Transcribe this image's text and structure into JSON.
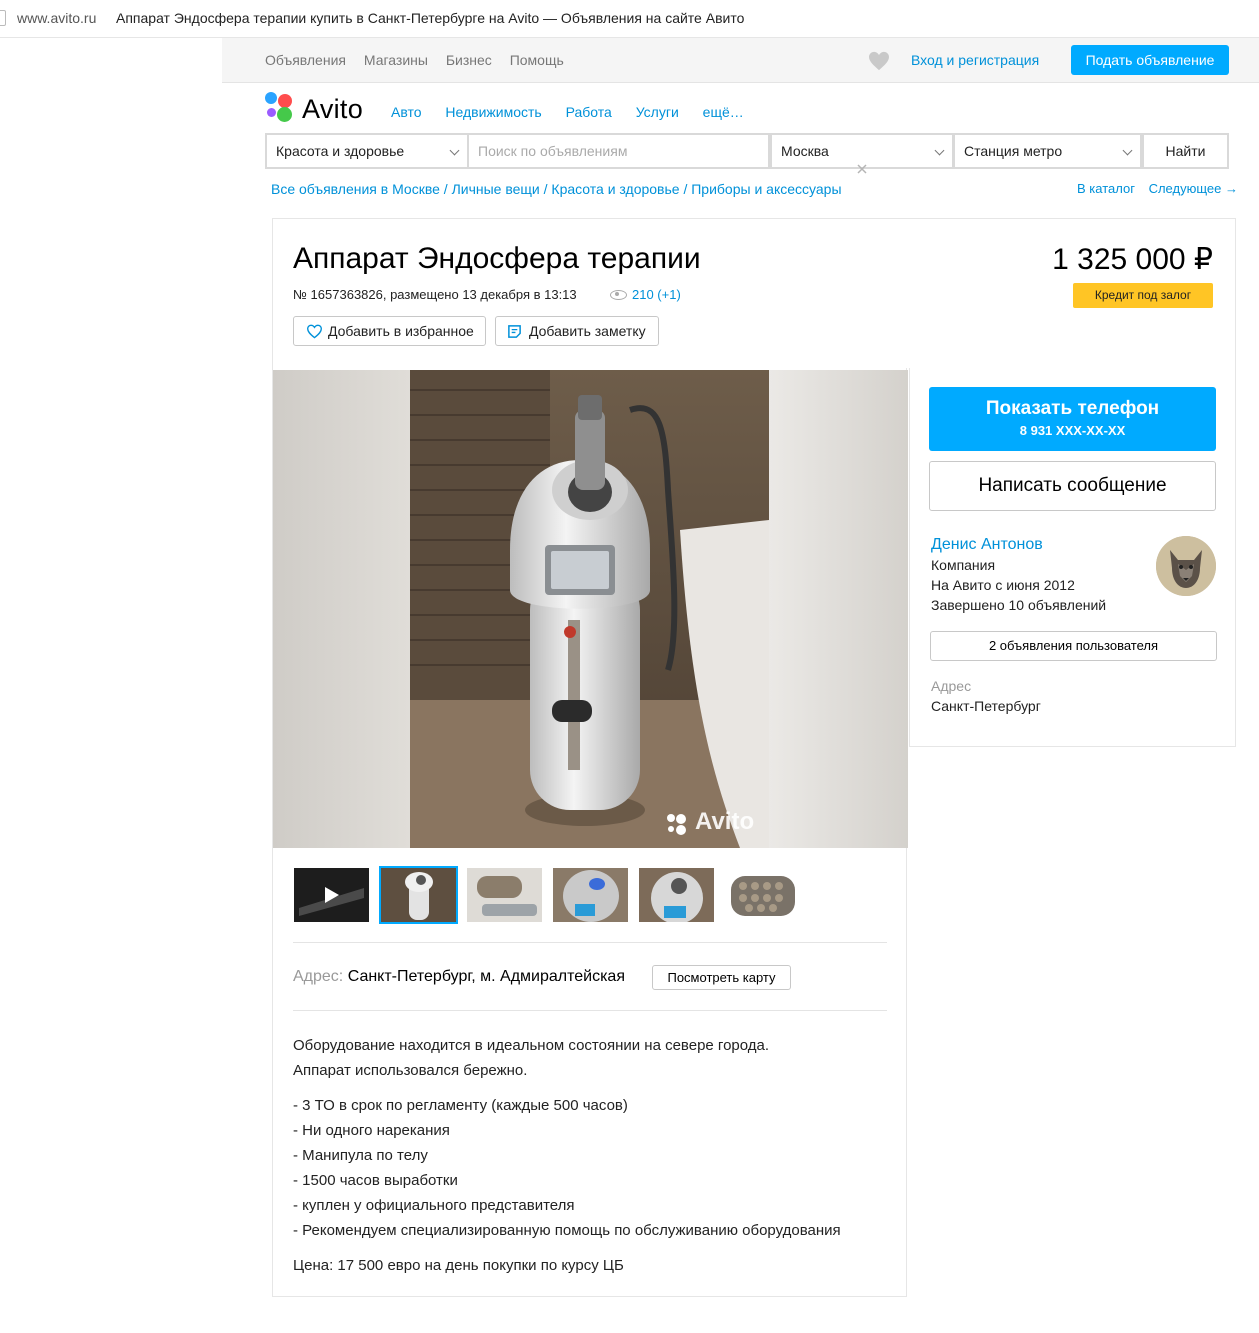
{
  "browser": {
    "url": "www.avito.ru",
    "title": "Аппарат Эндосфера терапии купить в Санкт-Петербурге на Avito — Объявления на сайте Авито"
  },
  "topnav": {
    "links": [
      "Объявления",
      "Магазины",
      "Бизнес",
      "Помощь"
    ],
    "login": "Вход и регистрация",
    "post_ad": "Подать объявление"
  },
  "logo": {
    "text": "Avito"
  },
  "categories": [
    "Авто",
    "Недвижимость",
    "Работа",
    "Услуги",
    "ещё…"
  ],
  "search": {
    "category": "Красота и здоровье",
    "placeholder": "Поиск по объявлениям",
    "city": "Москва",
    "metro": "Станция метро",
    "button": "Найти"
  },
  "breadcrumbs": "Все объявления в Москве / Личные вещи / Красота и здоровье / Приборы и аксессуары",
  "crumb_links": [
    "В каталог",
    "Следующее →"
  ],
  "item": {
    "title": "Аппарат Эндосфера терапии",
    "meta": "№ 1657363826, размещено 13 декабря в 13:13",
    "views": "210 (+1)",
    "add_favorite": "Добавить в избранное",
    "add_note": "Добавить заметку",
    "price": "1 325 000 ₽",
    "credit": "Кредит под залог",
    "watermark": "Avito"
  },
  "address": {
    "label": "Адрес:",
    "value": "Санкт-Петербург, м. Адмиралтейская",
    "map_button": "Посмотреть карту"
  },
  "description": {
    "intro1": "Оборудование находится в идеальном состоянии на севере города.",
    "intro2": "Аппарат использовался бережно.",
    "bullets": [
      "- 3 ТО в срок по регламенту (каждые 500 часов)",
      "- Ни одного нарекания",
      "- Манипула по телу",
      "- 1500 часов выработки",
      "- куплен у официального представителя",
      "- Рекомендуем специализированную помощь по обслуживанию оборудования"
    ],
    "price_note": "Цена: 17 500 евро на день покупки по курсу ЦБ"
  },
  "seller": {
    "show_phone": "Показать телефон",
    "phone_mask": "8 931 XXX-XX-XX",
    "write_message": "Написать сообщение",
    "name": "Денис Антонов",
    "type": "Компания",
    "since": "На Авито с июня 2012",
    "completed": "Завершено 10 объявлений",
    "user_ads": "2 объявления пользователя",
    "address_label": "Адрес",
    "address": "Санкт-Петербург"
  },
  "colors": {
    "accent": "#00aaff",
    "link": "#0091d9",
    "credit": "#ffc525"
  }
}
